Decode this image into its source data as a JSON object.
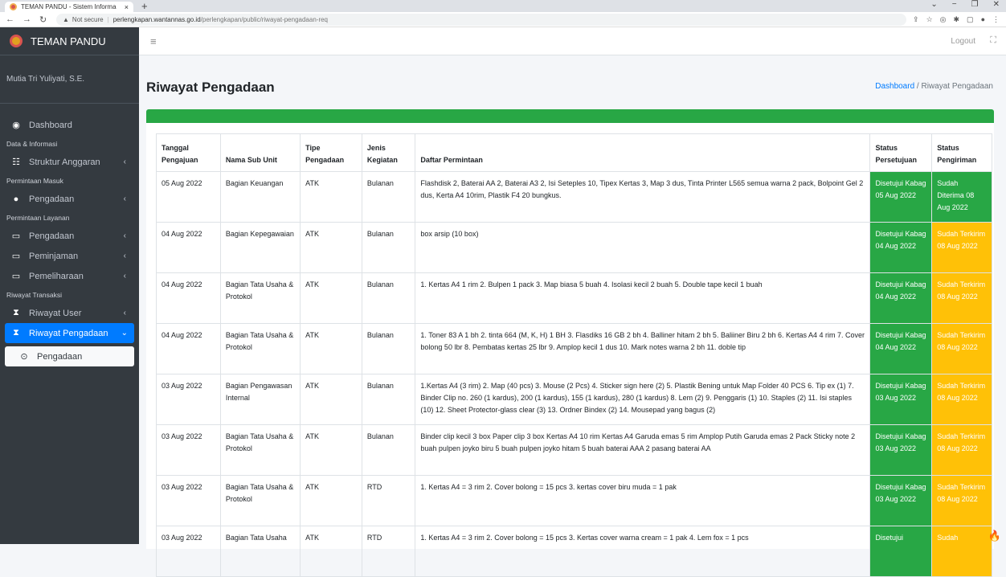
{
  "browser": {
    "tab_title": "TEMAN PANDU - Sistem Informa",
    "tab_close": "×",
    "new_tab": "+",
    "not_secure": "Not secure",
    "url_host": "perlengkapan.wantannas.go.id",
    "url_path": "/perlengkapan/public/riwayat-pengadaan-req"
  },
  "app": {
    "brand": "TEMAN PANDU",
    "user": "Mutia Tri Yuliyati, S.E.",
    "logout": "Logout"
  },
  "sidebar": {
    "dashboard": "Dashboard",
    "h1": "Data & Informasi",
    "struktur": "Struktur Anggaran",
    "h2": "Permintaan Masuk",
    "pengadaan_masuk": "Pengadaan",
    "h3": "Permintaan Layanan",
    "pengadaan_layanan": "Pengadaan",
    "peminjaman": "Peminjaman",
    "pemeliharaan": "Pemeliharaan",
    "h4": "Riwayat Transaksi",
    "riwayat_user": "Riwayat User",
    "riwayat_pengadaan": "Riwayat Pengadaan",
    "sub_pengadaan": "Pengadaan"
  },
  "page": {
    "title": "Riwayat Pengadaan",
    "crumb_home": "Dashboard",
    "crumb_sep": "/",
    "crumb_current": "Riwayat Pengadaan"
  },
  "table": {
    "headers": {
      "tanggal": "Tanggal Pengajuan",
      "nama": "Nama Sub Unit",
      "tipe": "Tipe Pengadaan",
      "jenis": "Jenis Kegiatan",
      "daftar": "Daftar Permintaan",
      "persetujuan": "Status Persetujuan",
      "pengiriman": "Status Pengiriman"
    },
    "rows": [
      {
        "tanggal": "05 Aug 2022",
        "nama": "Bagian Keuangan",
        "tipe": "ATK",
        "jenis": "Bulanan",
        "daftar": "Flashdisk 2, Baterai AA 2, Baterai A3 2, Isi Seteples 10, Tipex Kertas 3, Map 3 dus, Tinta Printer L565 semua warna 2 pack, Bolpoint Gel 2 dus, Kerta A4 10rim, Plastik F4 20 bungkus.",
        "persetujuan": "Disetujui Kabag 05 Aug 2022",
        "pengiriman": "Sudah Diterima 08 Aug 2022"
      },
      {
        "tanggal": "04 Aug 2022",
        "nama": "Bagian Kepegawaian",
        "tipe": "ATK",
        "jenis": "Bulanan",
        "daftar": "box arsip (10 box)",
        "persetujuan": "Disetujui Kabag 04 Aug 2022",
        "pengiriman": "Sudah Terkirim 08 Aug 2022"
      },
      {
        "tanggal": "04 Aug 2022",
        "nama": "Bagian Tata Usaha & Protokol",
        "tipe": "ATK",
        "jenis": "Bulanan",
        "daftar": "1. Kertas A4 1 rim 2. Bulpen 1 pack 3. Map biasa 5 buah 4. Isolasi kecil 2 buah 5. Double tape kecil 1 buah",
        "persetujuan": "Disetujui Kabag 04 Aug 2022",
        "pengiriman": "Sudah Terkirim 08 Aug 2022"
      },
      {
        "tanggal": "04 Aug 2022",
        "nama": "Bagian Tata Usaha & Protokol",
        "tipe": "ATK",
        "jenis": "Bulanan",
        "daftar": "1. Toner 83 A 1 bh 2. tinta 664 (M, K, H) 1 BH 3. Flasdiks 16 GB 2 bh 4. Balliner hitam 2 bh 5. Baliiner Biru 2 bh 6. Kertas A4 4 rim 7. Cover bolong 50 lbr 8. Pembatas kertas 25 lbr 9. Amplop kecil 1 dus 10. Mark notes warna 2 bh 11. doble tip",
        "persetujuan": "Disetujui Kabag 04 Aug 2022",
        "pengiriman": "Sudah Terkirim 08 Aug 2022"
      },
      {
        "tanggal": "03 Aug 2022",
        "nama": "Bagian Pengawasan Internal",
        "tipe": "ATK",
        "jenis": "Bulanan",
        "daftar": "1.Kertas A4 (3 rim) 2. Map (40 pcs) 3. Mouse (2 Pcs) 4. Sticker sign here (2) 5. Plastik Bening untuk Map Folder 40 PCS 6. Tip ex (1) 7. Binder Clip no. 260 (1 kardus), 200 (1 kardus), 155 (1 kardus), 280 (1 kardus) 8. Lem (2) 9. Penggaris (1) 10. Staples (2) 11. Isi staples (10) 12. Sheet Protector-glass clear (3) 13. Ordner Bindex (2) 14. Mousepad yang bagus (2)",
        "persetujuan": "Disetujui Kabag 03 Aug 2022",
        "pengiriman": "Sudah Terkirim 08 Aug 2022"
      },
      {
        "tanggal": "03 Aug 2022",
        "nama": "Bagian Tata Usaha & Protokol",
        "tipe": "ATK",
        "jenis": "Bulanan",
        "daftar": "Binder clip kecil 3 box Paper clip 3 box Kertas A4 10 rim Kertas A4 Garuda emas 5 rim Amplop Putih Garuda emas 2 Pack Sticky note 2 buah pulpen joyko biru 5 buah pulpen joyko hitam 5 buah baterai AAA 2 pasang baterai AA",
        "persetujuan": "Disetujui Kabag 03 Aug 2022",
        "pengiriman": "Sudah Terkirim 08 Aug 2022"
      },
      {
        "tanggal": "03 Aug 2022",
        "nama": "Bagian Tata Usaha & Protokol",
        "tipe": "ATK",
        "jenis": "RTD",
        "daftar": "1. Kertas A4 = 3 rim 2. Cover bolong = 15 pcs 3. kertas cover biru muda = 1 pak",
        "persetujuan": "Disetujui Kabag 03 Aug 2022",
        "pengiriman": "Sudah Terkirim 08 Aug 2022"
      },
      {
        "tanggal": "03 Aug 2022",
        "nama": "Bagian Tata Usaha",
        "tipe": "ATK",
        "jenis": "RTD",
        "daftar": "1. Kertas A4 = 3 rim 2. Cover bolong = 15 pcs 3. Kertas cover warna cream = 1 pak 4. Lem fox = 1 pcs",
        "persetujuan": "Disetujui",
        "pengiriman": "Sudah"
      }
    ]
  },
  "colors": {
    "sidebar": "#343a40",
    "active": "#007bff",
    "approved": "#28a745",
    "shipped": "#ffc107"
  }
}
